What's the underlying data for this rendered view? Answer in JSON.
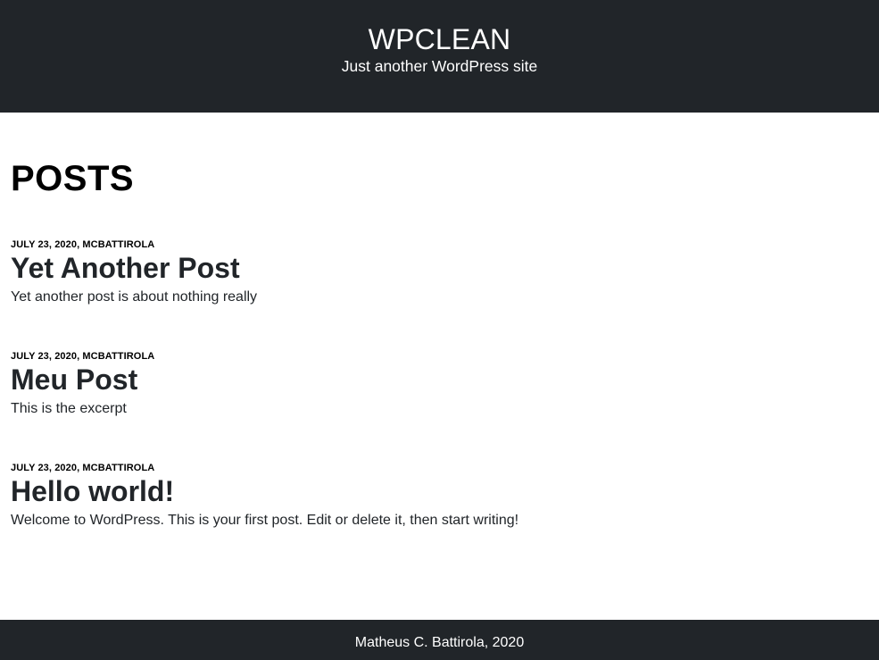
{
  "header": {
    "site_title": "WPCLEAN",
    "tagline": "Just another WordPress site"
  },
  "main": {
    "heading": "POSTS",
    "posts": [
      {
        "meta": "JULY 23, 2020, MCBATTIROLA",
        "title": "Yet Another Post",
        "excerpt": "Yet another post is about nothing really"
      },
      {
        "meta": "JULY 23, 2020, MCBATTIROLA",
        "title": "Meu Post",
        "excerpt": "This is the excerpt"
      },
      {
        "meta": "JULY 23, 2020, MCBATTIROLA",
        "title": "Hello world!",
        "excerpt": "Welcome to WordPress. This is your first post. Edit or delete it, then start writing!"
      }
    ]
  },
  "footer": {
    "text": "Matheus C. Battirola, 2020"
  },
  "colors": {
    "header_bg": "#212529",
    "text": "#212529"
  }
}
